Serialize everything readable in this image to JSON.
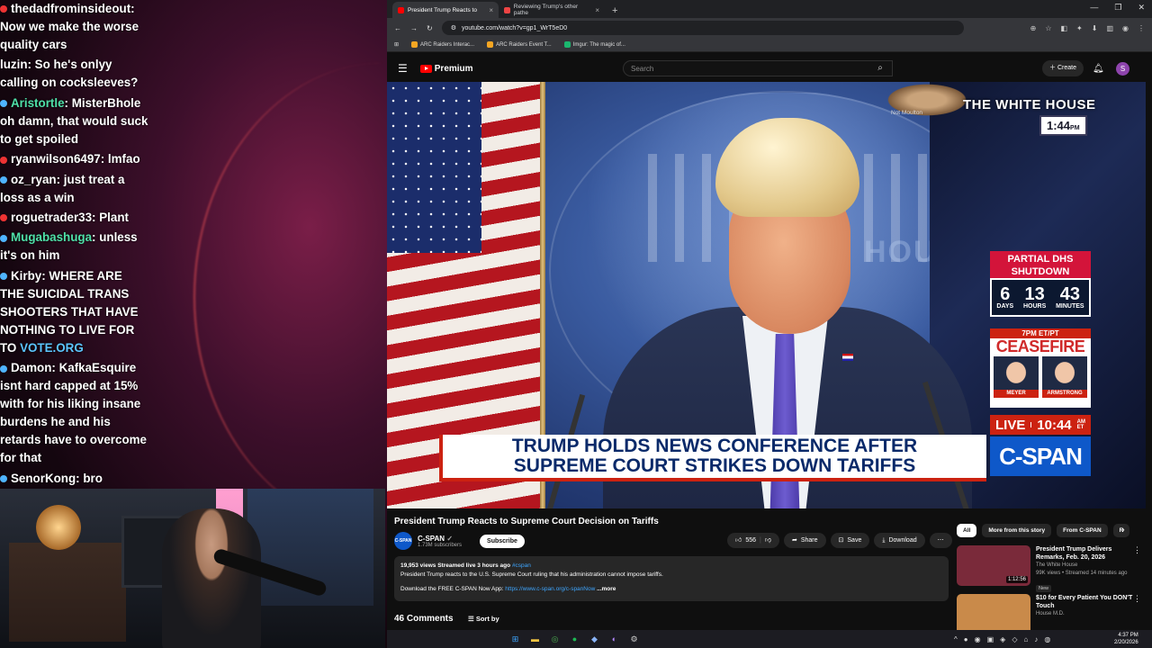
{
  "chat": [
    {
      "user": "",
      "text": "thedadfrominsideout: Now we make the worse quality cars",
      "dot": "red",
      "username_color": "white"
    },
    {
      "user": "",
      "text": "luzin: So he's onlyy calling on cocksleeves?",
      "dot": "",
      "username_color": "white"
    },
    {
      "user": "Aristortle",
      "text": ": MisterBhole oh damn, that would suck to get spoiled",
      "dot": "blue",
      "username_color": "green"
    },
    {
      "user": "ryanwilson6497",
      "text": ": lmfao",
      "dot": "red",
      "username_color": "white"
    },
    {
      "user": "oz_ryan",
      "text": ": just treat a loss as a win",
      "dot": "blue",
      "username_color": "white"
    },
    {
      "user": "roguetrader33",
      "text": ": Plant",
      "dot": "red",
      "username_color": "white"
    },
    {
      "user": "Mugabashuga",
      "text": ": unless it's on him",
      "dot": "blue",
      "username_color": "green"
    },
    {
      "user": "Kirby",
      "text": ": WHERE ARE THE SUICIDAL TRANS SHOOTERS THAT HAVE NOTHING TO LIVE FOR TO ",
      "link": "VOTE.ORG",
      "dot": "blue",
      "username_color": "white"
    },
    {
      "user": "Damon",
      "text": ": KafkaEsquire isnt      hard capped at 15% with for his liking insane burdens he and his retards have to overcome for that",
      "dot": "blue",
      "username_color": "white"
    },
    {
      "user": "SenorKong",
      "text": ": bro",
      "dot": "blue",
      "username_color": "white"
    }
  ],
  "browser": {
    "tabs": [
      {
        "label": "President Trump Reacts to",
        "active": true
      },
      {
        "label": "Reviewing Trump's other pathe",
        "active": false
      }
    ],
    "new_tab": "+",
    "url": "youtube.com/watch?v=gp1_WrT5eD0",
    "bookmarks": [
      "ARC Raiders Interac...",
      "ARC Raiders Event T...",
      "Imgur: The magic of..."
    ],
    "window_controls": [
      "—",
      "❐",
      "✕"
    ]
  },
  "yt": {
    "logo": "Premium",
    "search_placeholder": "Search",
    "create": "Create",
    "avatar_letter": "S",
    "overlay_label": "Not Moulton"
  },
  "video": {
    "bug_title": "THE WHITE HOUSE",
    "bug_time": "1:44",
    "bug_time_suffix": "PM",
    "dhs_title": "PARTIAL DHS SHUTDOWN",
    "dhs_days": "6",
    "dhs_days_label": "DAYS",
    "dhs_hours": "13",
    "dhs_hours_label": "HOURS",
    "dhs_minutes": "43",
    "dhs_minutes_label": "MINUTES",
    "cf_time": "7PM ET/PT",
    "cf_title": "CEASEFIRE",
    "cf_guest1": "MEYER",
    "cf_guest2": "ARMSTRONG",
    "live_label": "LIVE",
    "live_time": "10:44",
    "live_tz": "AM ET",
    "network": "C-SPAN",
    "chyron_line1": "TRUMP HOLDS NEWS CONFERENCE AFTER",
    "chyron_line2": "SUPREME COURT STRIKES DOWN TARIFFS",
    "backdrop_text": "HOUSE"
  },
  "info": {
    "title": "President Trump Reacts to Supreme Court Decision on Tariffs",
    "channel": "C-SPAN",
    "channel_logo": "C-SPAN",
    "subscribers": "1.73M subscribers",
    "subscribe": "Subscribe",
    "likes": "556",
    "share": "Share",
    "save": "Save",
    "download": "Download",
    "desc_meta": "19,953 views  Streamed live 3 hours ago",
    "desc_tag": "#cspan",
    "desc_text": "President Trump reacts to the U.S. Supreme Court ruling that his administration cannot impose tariffs.",
    "desc_app": "Download the FREE C-SPAN Now App:",
    "desc_link": "https://www.c-span.org/c-spanNow",
    "desc_more": "...more",
    "comments": "46 Comments",
    "sort_by": "Sort by"
  },
  "rail": {
    "chips": [
      "All",
      "More from this story",
      "From C-SPAN",
      "R"
    ],
    "recs": [
      {
        "title": "President Trump Delivers Remarks, Feb. 20, 2026",
        "channel": "The White House",
        "meta": "99K views • Streamed 14 minutes ago",
        "badge": "New",
        "duration": "1:12:56",
        "thumb_color": "#7a2a3a"
      },
      {
        "title": "$10 for Every Patient You DON'T Touch",
        "channel": "House M.D.",
        "meta": "",
        "badge": "",
        "duration": "",
        "thumb_color": "#c98a4a"
      }
    ]
  },
  "taskbar": {
    "time": "4:37 PM",
    "date": "2/20/2026"
  }
}
